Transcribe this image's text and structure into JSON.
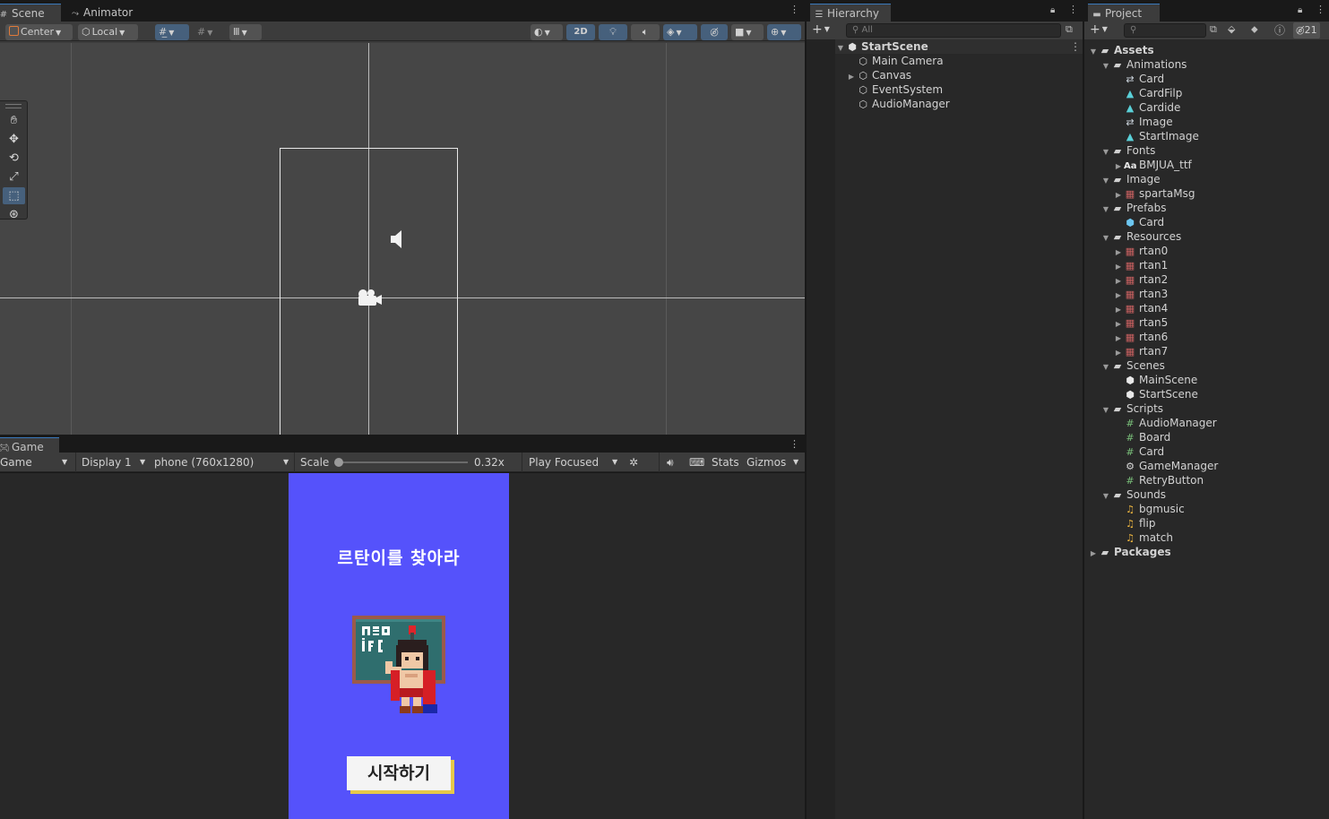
{
  "scene_panel": {
    "tabs": [
      {
        "label": "Scene",
        "icon": "grid-icon"
      },
      {
        "label": "Animator",
        "icon": "animator-icon"
      }
    ],
    "toolbar": {
      "pivot": "Center",
      "space": "Local",
      "mode_2d": "2D"
    }
  },
  "game_panel": {
    "tab_label": "Game",
    "view_select": "Game",
    "display": "Display 1",
    "resolution": "phone (760x1280)",
    "scale_label": "Scale",
    "scale_value": "0.32x",
    "play_mode": "Play Focused",
    "stats": "Stats",
    "gizmos": "Gizmos",
    "game_screen": {
      "title": "르탄이를 찾아라",
      "start_button": "시작하기"
    }
  },
  "hierarchy": {
    "tab_label": "Hierarchy",
    "search_placeholder": "All",
    "scene_name": "StartScene",
    "items": [
      "Main Camera",
      "Canvas",
      "EventSystem",
      "AudioManager"
    ]
  },
  "project": {
    "tab_label": "Project",
    "hidden_count": "21",
    "root": "Assets",
    "tree": [
      {
        "depth": 1,
        "label": "Animations",
        "icon": "folder-icon",
        "arrow": "open"
      },
      {
        "depth": 2,
        "label": "Card",
        "icon": "animator-controller-icon",
        "arrow": ""
      },
      {
        "depth": 2,
        "label": "CardFilp",
        "icon": "animation-clip-icon",
        "arrow": ""
      },
      {
        "depth": 2,
        "label": "Cardide",
        "icon": "animation-clip-icon",
        "arrow": ""
      },
      {
        "depth": 2,
        "label": "Image",
        "icon": "animator-controller-icon",
        "arrow": ""
      },
      {
        "depth": 2,
        "label": "StartImage",
        "icon": "animation-clip-icon",
        "arrow": ""
      },
      {
        "depth": 1,
        "label": "Fonts",
        "icon": "folder-icon",
        "arrow": "open"
      },
      {
        "depth": 2,
        "label": "BMJUA_ttf",
        "icon": "font-icon",
        "arrow": "closed"
      },
      {
        "depth": 1,
        "label": "Image",
        "icon": "folder-icon",
        "arrow": "open"
      },
      {
        "depth": 2,
        "label": "spartaMsg",
        "icon": "sprite-icon",
        "arrow": "closed"
      },
      {
        "depth": 1,
        "label": "Prefabs",
        "icon": "folder-icon",
        "arrow": "open"
      },
      {
        "depth": 2,
        "label": "Card",
        "icon": "prefab-icon",
        "arrow": ""
      },
      {
        "depth": 1,
        "label": "Resources",
        "icon": "folder-icon",
        "arrow": "open"
      },
      {
        "depth": 2,
        "label": "rtan0",
        "icon": "sprite-icon",
        "arrow": "closed"
      },
      {
        "depth": 2,
        "label": "rtan1",
        "icon": "sprite-icon",
        "arrow": "closed"
      },
      {
        "depth": 2,
        "label": "rtan2",
        "icon": "sprite-icon",
        "arrow": "closed"
      },
      {
        "depth": 2,
        "label": "rtan3",
        "icon": "sprite-icon",
        "arrow": "closed"
      },
      {
        "depth": 2,
        "label": "rtan4",
        "icon": "sprite-icon",
        "arrow": "closed"
      },
      {
        "depth": 2,
        "label": "rtan5",
        "icon": "sprite-icon",
        "arrow": "closed"
      },
      {
        "depth": 2,
        "label": "rtan6",
        "icon": "sprite-icon",
        "arrow": "closed"
      },
      {
        "depth": 2,
        "label": "rtan7",
        "icon": "sprite-icon",
        "arrow": "closed"
      },
      {
        "depth": 1,
        "label": "Scenes",
        "icon": "folder-icon",
        "arrow": "open"
      },
      {
        "depth": 2,
        "label": "MainScene",
        "icon": "scene-icon",
        "arrow": ""
      },
      {
        "depth": 2,
        "label": "StartScene",
        "icon": "scene-icon",
        "arrow": ""
      },
      {
        "depth": 1,
        "label": "Scripts",
        "icon": "folder-icon",
        "arrow": "open"
      },
      {
        "depth": 2,
        "label": "AudioManager",
        "icon": "script-icon",
        "arrow": ""
      },
      {
        "depth": 2,
        "label": "Board",
        "icon": "script-icon",
        "arrow": ""
      },
      {
        "depth": 2,
        "label": "Card",
        "icon": "script-icon",
        "arrow": ""
      },
      {
        "depth": 2,
        "label": "GameManager",
        "icon": "gear-icon",
        "arrow": ""
      },
      {
        "depth": 2,
        "label": "RetryButton",
        "icon": "script-icon",
        "arrow": ""
      },
      {
        "depth": 1,
        "label": "Sounds",
        "icon": "folder-icon",
        "arrow": "open"
      },
      {
        "depth": 2,
        "label": "bgmusic",
        "icon": "audio-icon",
        "arrow": ""
      },
      {
        "depth": 2,
        "label": "flip",
        "icon": "audio-icon",
        "arrow": ""
      },
      {
        "depth": 2,
        "label": "match",
        "icon": "audio-icon",
        "arrow": ""
      }
    ],
    "packages": "Packages"
  },
  "colors": {
    "game_background": "#5552fb",
    "selection_blue": "#46607c"
  }
}
